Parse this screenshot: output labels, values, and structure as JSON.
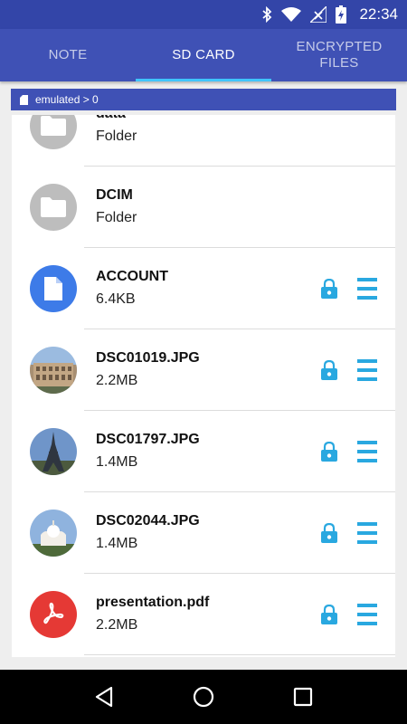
{
  "status": {
    "time": "22:34"
  },
  "tabs": [
    {
      "label": "NOTE"
    },
    {
      "label": "SD CARD"
    },
    {
      "label": "ENCRYPTED FILES"
    }
  ],
  "breadcrumb": {
    "path": "emulated > 0"
  },
  "files": [
    {
      "name": "data",
      "detail": "Folder",
      "type": "folder"
    },
    {
      "name": "DCIM",
      "detail": "Folder",
      "type": "folder"
    },
    {
      "name": "ACCOUNT",
      "detail": "6.4KB",
      "type": "document"
    },
    {
      "name": "DSC01019.JPG",
      "detail": "2.2MB",
      "type": "image-colosseum"
    },
    {
      "name": "DSC01797.JPG",
      "detail": "1.4MB",
      "type": "image-eiffel"
    },
    {
      "name": "DSC02044.JPG",
      "detail": "1.4MB",
      "type": "image-basilica"
    },
    {
      "name": "presentation.pdf",
      "detail": "2.2MB",
      "type": "pdf"
    }
  ],
  "colors": {
    "primary": "#3f51b5",
    "primary_dark": "#3345a8",
    "accent": "#29a8e0",
    "tab_indicator": "#40c4ff",
    "pdf_red": "#e53935",
    "doc_blue": "#3d7be8"
  }
}
